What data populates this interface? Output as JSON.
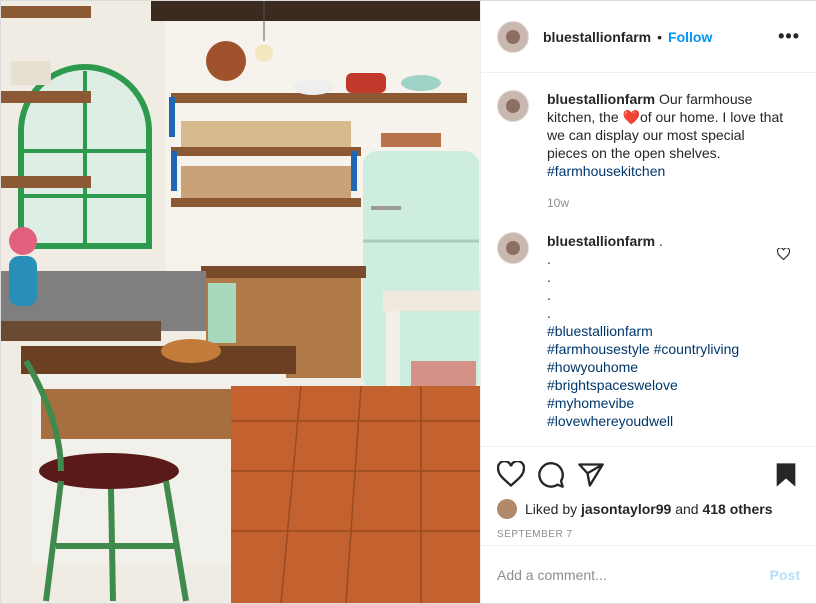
{
  "header": {
    "username": "bluestallionfarm",
    "separator": "•",
    "follow_label": "Follow",
    "more_label": "•••"
  },
  "caption": {
    "username": "bluestallionfarm",
    "text_before": "Our farmhouse kitchen, the",
    "heart_emoji": "❤️",
    "text_after": "of our home. I love that we can display our most special pieces on the open shelves.",
    "hashtag": "#farmhousekitchen",
    "age": "10w"
  },
  "comment": {
    "username": "bluestallionfarm",
    "dots": [
      ".",
      ".",
      ".",
      ".",
      "."
    ],
    "hashtags": [
      "#bluestallionfarm",
      "#farmhousestyle #countryliving",
      "#howyouhome",
      "#brightspaceswelove",
      "#myhomevibe",
      "#lovewhereyoudwell"
    ]
  },
  "likes": {
    "prefix": "Liked by",
    "user": "jasontaylor99",
    "middle": "and",
    "others": "418 others"
  },
  "date": "SEPTEMBER 7",
  "add_comment": {
    "placeholder": "Add a comment...",
    "post_label": "Post"
  },
  "colors": {
    "accent": "#0095f6",
    "hashtag": "#00376b",
    "post_disabled": "#b2dffc"
  },
  "icons": [
    "like-icon",
    "comment-icon",
    "share-icon",
    "save-icon",
    "more-icon",
    "heart-small-icon"
  ]
}
